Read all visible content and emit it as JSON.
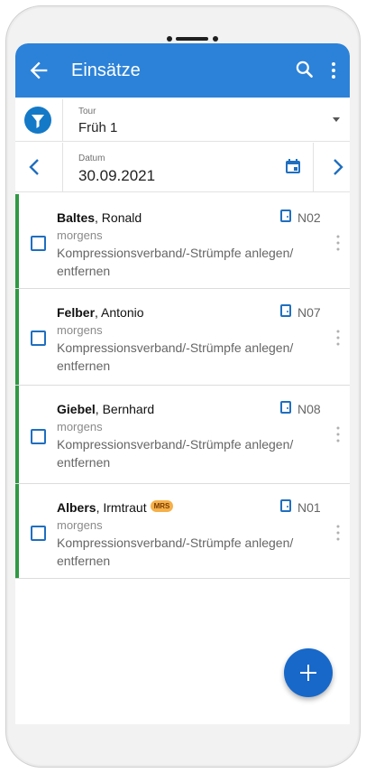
{
  "appbar": {
    "title": "Einsätze"
  },
  "filter": {
    "label": "Tour",
    "value": "Früh 1"
  },
  "date": {
    "label": "Datum",
    "value": "30.09.2021"
  },
  "visits": [
    {
      "last": "Baltes",
      "first": ", Ronald",
      "badge": "",
      "room": "N02",
      "time": "morgens",
      "task": "Kompressionsverband/-Strümpfe anlegen/ entfernen"
    },
    {
      "last": "Felber",
      "first": ", Antonio",
      "badge": "",
      "room": "N07",
      "time": "morgens",
      "task": "Kompressionsverband/-Strümpfe anlegen/ entfernen"
    },
    {
      "last": "Giebel",
      "first": ", Bernhard",
      "badge": "",
      "room": "N08",
      "time": "morgens",
      "task": "Kompressionsverband/-Strümpfe anlegen/ entfernen"
    },
    {
      "last": "Albers",
      "first": ", Irmtraut",
      "badge": "MRS",
      "room": "N01",
      "time": "morgens",
      "task": "Kompressionsverband/-Strümpfe anlegen/ entfernen"
    }
  ],
  "colors": {
    "primary": "#2c82d8",
    "fab": "#1768c9",
    "status_bar": "#2e9a44",
    "badge": "#f5b04a"
  },
  "icons": [
    "back-arrow-icon",
    "search-icon",
    "more-vert-icon",
    "filter-icon",
    "chevron-left-icon",
    "calendar-icon",
    "chevron-right-icon",
    "room-icon",
    "checkbox-icon",
    "plus-icon"
  ]
}
